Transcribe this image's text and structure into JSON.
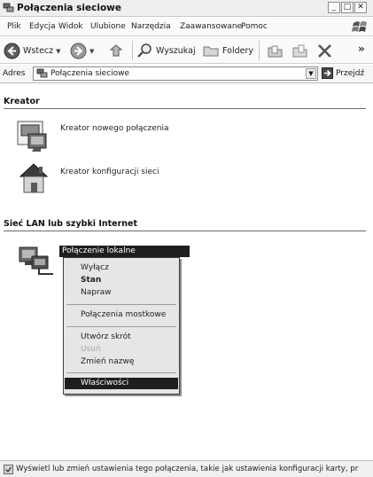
{
  "window": {
    "title": "Połączenia sieciowe",
    "minimize": "_",
    "maximize": "□",
    "close": "✕"
  },
  "menu": [
    "Plik",
    "Edycja",
    "Widok",
    "Ulubione",
    "Narzędzia",
    "Zaawansowane",
    "Pomoc"
  ],
  "toolbar": {
    "back": "Wstecz",
    "search": "Wyszukaj",
    "folders": "Foldery",
    "more": "»"
  },
  "address": {
    "label": "Adres",
    "value": "Połączenia sieciowe",
    "go": "Przejdź"
  },
  "groups": {
    "wizard": {
      "title": "Kreator",
      "items": [
        "Kreator nowego połączenia",
        "Kreator konfiguracji sieci"
      ]
    },
    "lan": {
      "title": "Sieć LAN lub szybki Internet",
      "selected_item": "Połączenie lokalne"
    }
  },
  "context_menu": {
    "items": [
      "Wyłącz",
      "Stan",
      "Napraw",
      "Połączenia mostkowe",
      "Utwórz skrót",
      "Usuń",
      "Zmień nazwę",
      "Właściwości"
    ],
    "bold_item": "Stan",
    "disabled_item": "Usuń",
    "highlighted_item": "Właściwości"
  },
  "status": {
    "text": "Wyświetl lub zmień ustawienia tego połączenia, takie jak ustawienia konfiguracji karty, pr"
  },
  "colors": {
    "selection": "#1e1e1e",
    "menu_bg": "#e6e6e6",
    "group_line": "#6d6d6d"
  }
}
